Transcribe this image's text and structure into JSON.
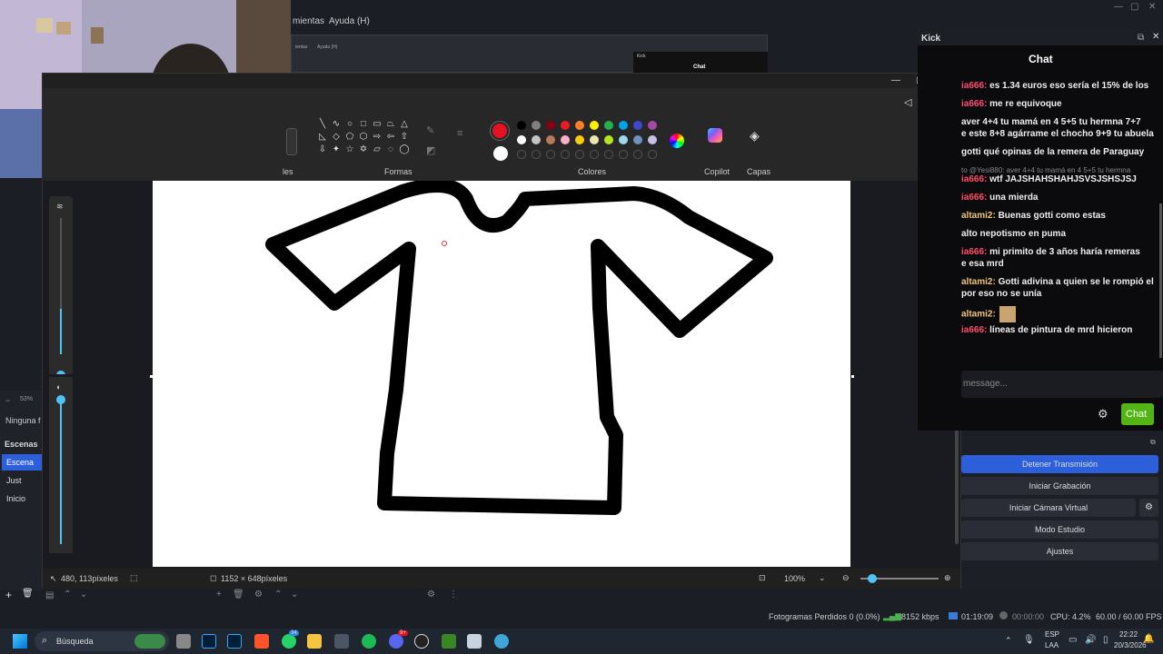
{
  "obs": {
    "menu": {
      "tools_partial": "mientas",
      "help": "Ayuda (H)"
    },
    "mini_menu": {
      "tools": "ientas",
      "help": "Ayuda (H)"
    },
    "mini_kick": "Kick",
    "mini_chat": "Chat",
    "zoom_percent": "53%",
    "source_label": "Ninguna f",
    "scenes_header": "Escenas",
    "scenes": [
      "Escena",
      "Just",
      "Inicio"
    ],
    "status": {
      "dropped_frames": "Fotogramas Perdidos 0 (0.0%)",
      "bitrate": "8152 kbps",
      "stream_time": "01:19:09",
      "rec_time": "00:00:00",
      "cpu": "CPU: 4.2%",
      "fps": "60.00 / 60.00 FPS"
    }
  },
  "paint": {
    "sections": {
      "shapes": "Formas",
      "colors": "Colores",
      "copilot": "Copilot",
      "layers": "Capas",
      "partial_left": "les"
    },
    "status": {
      "cursor": "480, 113píxeles",
      "size": "1152 × 648píxeles",
      "zoom": "100%"
    },
    "colors": {
      "primary": "#e81123",
      "secondary": "#ffffff",
      "row1": [
        "#000000",
        "#7f7f7f",
        "#880015",
        "#ed1c24",
        "#ff7f27",
        "#fff200",
        "#22b14c",
        "#00a2e8",
        "#3f48cc",
        "#a349a4"
      ],
      "row2": [
        "#ffffff",
        "#c3c3c3",
        "#b97a57",
        "#ffaec9",
        "#ffc90e",
        "#efe4b0",
        "#b5e61d",
        "#99d9ea",
        "#7092be",
        "#c8bfe7"
      ]
    }
  },
  "chat": {
    "title": "Kick",
    "header": "Chat",
    "messages": [
      {
        "user": "ia666:",
        "text": " es 1.34 euros eso sería el 15% de los",
        "cont": "",
        "color": "#ff4d6d"
      },
      {
        "user": "ia666:",
        "text": " me re equivoque",
        "cont": "",
        "color": "#ff4d6d"
      },
      {
        "user": "",
        "text": "aver 4+4 tu mamá en 4 5+5 tu hermna 7+7",
        "cont": "e este 8+8 agárrame el chocho 9+9 tu abuela",
        "color": "#eeeeee"
      },
      {
        "user": "",
        "text": "gotti qué opinas de la remera de Paraguay",
        "cont": "",
        "color": "#eeeeee"
      },
      {
        "user": "",
        "text": "to @Yesi880: aver 4+4 tu mamá en 4 5+5 tu hermna",
        "cont": "",
        "color": "#888888"
      },
      {
        "user": "ia666:",
        "text": " wtf JAJSHAHSHAHJSVSJSHSJSJ",
        "cont": "",
        "color": "#ff4d6d"
      },
      {
        "user": "ia666:",
        "text": " una mierda",
        "cont": "",
        "color": "#ff4d6d"
      },
      {
        "user": "altami2:",
        "text": " Buenas gotti como estas",
        "cont": "",
        "color": "#f0c27b"
      },
      {
        "user": "",
        "text": "alto nepotismo en puma",
        "cont": "",
        "color": "#eeeeee"
      },
      {
        "user": "ia666:",
        "text": " mi primito de 3 años haría remeras",
        "cont": "e esa mrd",
        "color": "#ff4d6d"
      },
      {
        "user": "altami2:",
        "text": " Gotti adivina a quien se le rompió el",
        "cont": "por eso no se unía",
        "color": "#f0c27b"
      },
      {
        "user": "altami2:",
        "text": "",
        "cont": "",
        "color": "#f0c27b"
      },
      {
        "user": "ia666:",
        "text": " líneas de pintura de mrd hicieron",
        "cont": "",
        "color": "#ff4d6d"
      }
    ],
    "input_placeholder": "message...",
    "send_label": "Chat"
  },
  "controls": {
    "stop_stream": "Detener Transmisión",
    "start_rec": "Iniciar Grabación",
    "virtual_cam": "Iniciar Cámara Virtual",
    "studio_mode": "Modo Estudio",
    "settings": "Ajustes"
  },
  "taskbar": {
    "search": "Búsqueda",
    "lang": "ESP",
    "layout": "LAA",
    "time": "22:22",
    "date": "20/3/2026",
    "badge_whatsapp": "34",
    "badge_discord": "9+"
  }
}
